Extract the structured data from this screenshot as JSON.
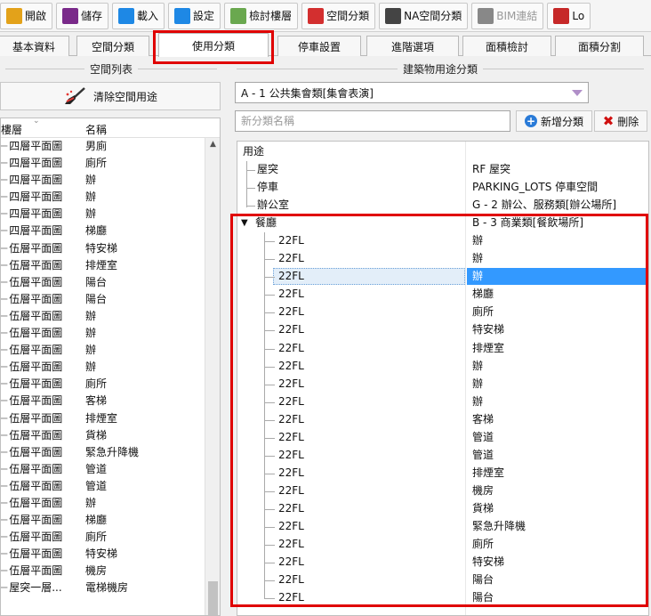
{
  "toolbar": {
    "items": [
      {
        "label": "開啟",
        "icon": "folder-open-icon",
        "color": "#e3a21a"
      },
      {
        "label": "儲存",
        "icon": "save-disk-icon",
        "color": "#7a2a8a"
      },
      {
        "label": "載入",
        "icon": "download-icon",
        "color": "#1e88e5"
      },
      {
        "label": "設定",
        "icon": "gear-icon",
        "color": "#1e88e5"
      },
      {
        "label": "檢討樓層",
        "icon": "floor-blocks-icon",
        "color": "#6aa84f"
      },
      {
        "label": "空間分類",
        "icon": "space-classify-icon",
        "color": "#d32f2f"
      },
      {
        "label": "NA空間分類",
        "icon": "na-classify-icon",
        "color": "#444444"
      },
      {
        "label": "BIM連結",
        "icon": "link-icon",
        "color": "#888888"
      },
      {
        "label": "Lo",
        "icon": "log-icon",
        "color": "#c62828"
      }
    ]
  },
  "tabs": [
    {
      "label": "基本資料"
    },
    {
      "label": "空間分類"
    },
    {
      "label": "使用分類"
    },
    {
      "label": "停車設置"
    },
    {
      "label": "進階選項"
    },
    {
      "label": "面積檢討"
    },
    {
      "label": "面積分割"
    }
  ],
  "left_panel": {
    "title": "空間列表",
    "clear_button": "清除空間用途",
    "columns": {
      "floor": "樓層",
      "name": "名稱"
    },
    "rows": [
      {
        "floor": "四層平面圖",
        "name": "男廁"
      },
      {
        "floor": "四層平面圖",
        "name": "廁所"
      },
      {
        "floor": "四層平面圖",
        "name": "辦"
      },
      {
        "floor": "四層平面圖",
        "name": "辦"
      },
      {
        "floor": "四層平面圖",
        "name": "辦"
      },
      {
        "floor": "四層平面圖",
        "name": "梯廳"
      },
      {
        "floor": "伍層平面圖",
        "name": "特安梯"
      },
      {
        "floor": "伍層平面圖",
        "name": "排煙室"
      },
      {
        "floor": "伍層平面圖",
        "name": "陽台"
      },
      {
        "floor": "伍層平面圖",
        "name": "陽台"
      },
      {
        "floor": "伍層平面圖",
        "name": "辦"
      },
      {
        "floor": "伍層平面圖",
        "name": "辦"
      },
      {
        "floor": "伍層平面圖",
        "name": "辦"
      },
      {
        "floor": "伍層平面圖",
        "name": "辦"
      },
      {
        "floor": "伍層平面圖",
        "name": "廁所"
      },
      {
        "floor": "伍層平面圖",
        "name": "客梯"
      },
      {
        "floor": "伍層平面圖",
        "name": "排煙室"
      },
      {
        "floor": "伍層平面圖",
        "name": "貨梯"
      },
      {
        "floor": "伍層平面圖",
        "name": "緊急升降機"
      },
      {
        "floor": "伍層平面圖",
        "name": "管道"
      },
      {
        "floor": "伍層平面圖",
        "name": "管道"
      },
      {
        "floor": "伍層平面圖",
        "name": "辦"
      },
      {
        "floor": "伍層平面圖",
        "name": "梯廳"
      },
      {
        "floor": "伍層平面圖",
        "name": "廁所"
      },
      {
        "floor": "伍層平面圖",
        "name": "特安梯"
      },
      {
        "floor": "伍層平面圖",
        "name": "機房"
      },
      {
        "floor": "屋突一層...",
        "name": "電梯機房"
      }
    ]
  },
  "right_panel": {
    "title": "建築物用途分類",
    "category_select": "A - 1 公共集會類[集會表演]",
    "new_name_placeholder": "新分類名稱",
    "add_button": "新增分類",
    "delete_button": "刪除",
    "tree_header": "用途",
    "top_items": [
      {
        "label": "屋突",
        "value": "RF 屋突"
      },
      {
        "label": "停車",
        "value": "PARKING_LOTS 停車空間"
      },
      {
        "label": "辦公室",
        "value": "G - 2 辦公、服務類[辦公場所]"
      }
    ],
    "group": {
      "label": "餐廳",
      "value": "B - 3 商業類[餐飲場所]",
      "expanded": true
    },
    "children": [
      {
        "floor": "22FL",
        "name": "辦"
      },
      {
        "floor": "22FL",
        "name": "辦"
      },
      {
        "floor": "22FL",
        "name": "辦",
        "selected": true
      },
      {
        "floor": "22FL",
        "name": "梯廳"
      },
      {
        "floor": "22FL",
        "name": "廁所"
      },
      {
        "floor": "22FL",
        "name": "特安梯"
      },
      {
        "floor": "22FL",
        "name": "排煙室"
      },
      {
        "floor": "22FL",
        "name": "辦"
      },
      {
        "floor": "22FL",
        "name": "辦"
      },
      {
        "floor": "22FL",
        "name": "辦"
      },
      {
        "floor": "22FL",
        "name": "客梯"
      },
      {
        "floor": "22FL",
        "name": "管道"
      },
      {
        "floor": "22FL",
        "name": "管道"
      },
      {
        "floor": "22FL",
        "name": "排煙室"
      },
      {
        "floor": "22FL",
        "name": "機房"
      },
      {
        "floor": "22FL",
        "name": "貨梯"
      },
      {
        "floor": "22FL",
        "name": "緊急升降機"
      },
      {
        "floor": "22FL",
        "name": "廁所"
      },
      {
        "floor": "22FL",
        "name": "特安梯"
      },
      {
        "floor": "22FL",
        "name": "陽台"
      },
      {
        "floor": "22FL",
        "name": "陽台"
      }
    ]
  },
  "colors": {
    "highlight_box": "#e00000",
    "selection": "#3399ff",
    "accent_blue": "#2a7bd8"
  }
}
